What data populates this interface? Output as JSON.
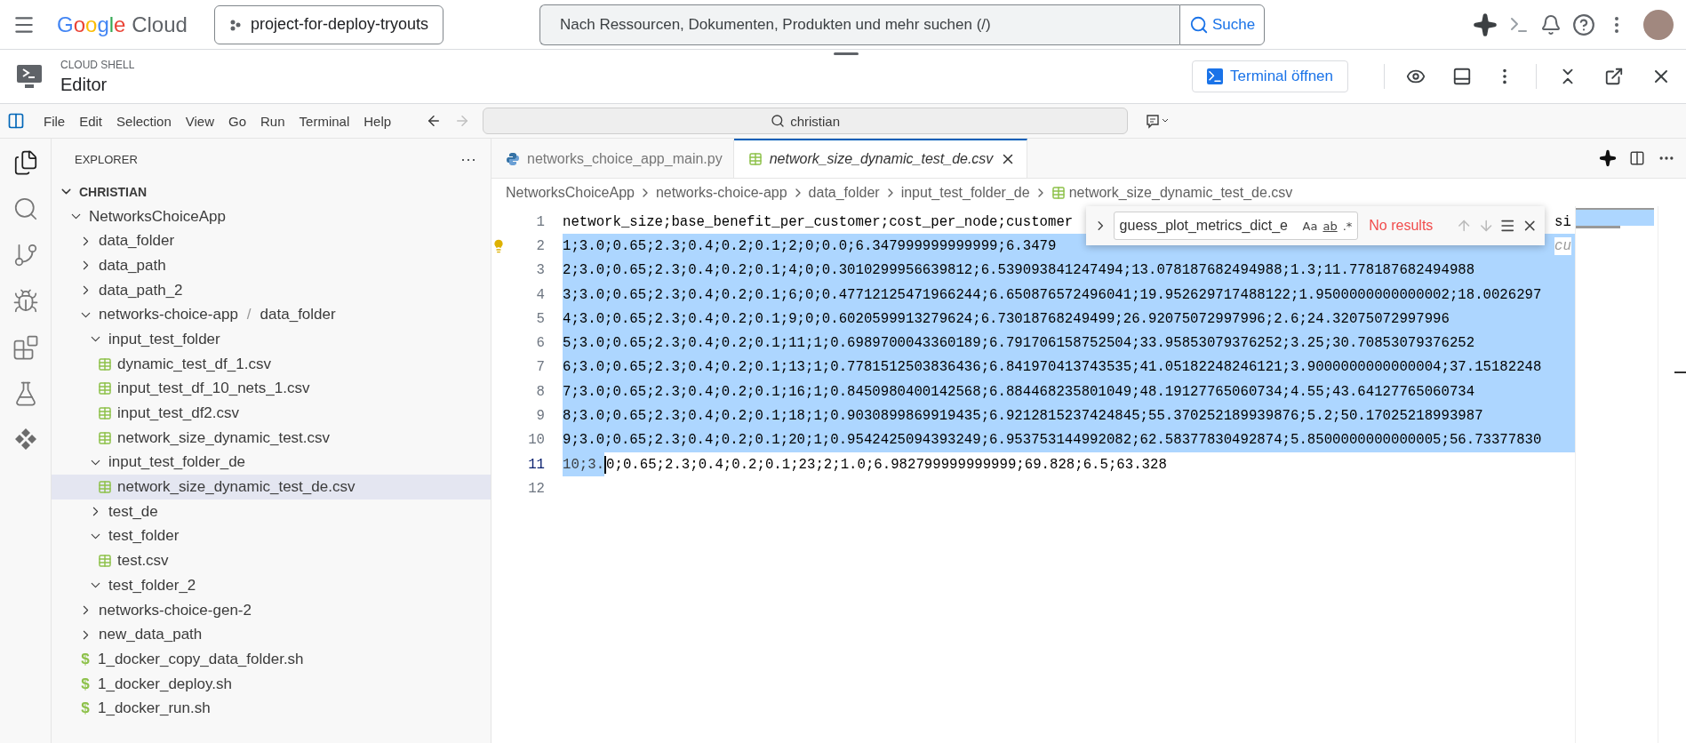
{
  "top_bar": {
    "logo": "Google Cloud",
    "project": "project-for-deploy-tryouts",
    "search": {
      "placeholder": "Nach Ressourcen, Dokumenten, Produkten und mehr suchen (/)"
    },
    "search_button": "Suche"
  },
  "shell_header": {
    "overline": "CLOUD SHELL",
    "title": "Editor",
    "terminal_button": "Terminal öffnen"
  },
  "menu_bar": {
    "items": [
      "File",
      "Edit",
      "Selection",
      "View",
      "Go",
      "Run",
      "Terminal",
      "Help"
    ],
    "command_center": "christian",
    "forward_disabled": true
  },
  "activity_bar": {
    "items": [
      {
        "kind": "files",
        "selected": true
      },
      {
        "kind": "search",
        "selected": false
      },
      {
        "kind": "git",
        "selected": false
      },
      {
        "kind": "debug",
        "selected": false
      },
      {
        "kind": "extensions",
        "selected": false
      },
      {
        "kind": "flask",
        "selected": false
      },
      {
        "kind": "gemini",
        "selected": false
      }
    ]
  },
  "explorer": {
    "title": "EXPLORER",
    "more": "···",
    "root": {
      "name": "CHRISTIAN",
      "expanded": true
    },
    "tree": [
      {
        "kind": "folder",
        "name": "NetworksChoiceApp",
        "expanded": true,
        "selected": false,
        "children": [
          {
            "kind": "folder",
            "name": "data_folder",
            "expanded": false,
            "selected": false
          },
          {
            "kind": "folder",
            "name": "data_path",
            "expanded": false,
            "selected": false
          },
          {
            "kind": "folder",
            "name": "data_path_2",
            "expanded": false,
            "selected": false
          },
          {
            "kind": "folder",
            "name": "networks-choice-app",
            "separator": "/",
            "compact": "data_folder",
            "expanded": true,
            "selected": false,
            "children": [
              {
                "kind": "folder",
                "name": "input_test_folder",
                "expanded": true,
                "selected": false,
                "children": [
                  {
                    "kind": "csv",
                    "name": "dynamic_test_df_1.csv",
                    "selected": false
                  },
                  {
                    "kind": "csv",
                    "name": "input_test_df_10_nets_1.csv",
                    "selected": false
                  },
                  {
                    "kind": "csv",
                    "name": "input_test_df2.csv",
                    "selected": false
                  },
                  {
                    "kind": "csv",
                    "name": "network_size_dynamic_test.csv",
                    "selected": false
                  }
                ]
              },
              {
                "kind": "folder",
                "name": "input_test_folder_de",
                "expanded": true,
                "selected": false,
                "children": [
                  {
                    "kind": "csv",
                    "name": "network_size_dynamic_test_de.csv",
                    "selected": true
                  }
                ]
              },
              {
                "kind": "folder",
                "name": "test_de",
                "expanded": false,
                "selected": false
              },
              {
                "kind": "folder",
                "name": "test_folder",
                "expanded": true,
                "selected": false,
                "children": [
                  {
                    "kind": "csv",
                    "name": "test.csv",
                    "selected": false
                  }
                ]
              },
              {
                "kind": "folder",
                "name": "test_folder_2",
                "expanded": true,
                "selected": false
              }
            ]
          },
          {
            "kind": "folder",
            "name": "networks-choice-gen-2",
            "expanded": false,
            "selected": false
          },
          {
            "kind": "folder",
            "name": "new_data_path",
            "expanded": false,
            "selected": false
          },
          {
            "kind": "shell",
            "icon": "$",
            "name": "1_docker_copy_data_folder.sh",
            "selected": false
          },
          {
            "kind": "shell",
            "icon": "$",
            "name": "1_docker_deploy.sh",
            "selected": false
          },
          {
            "kind": "shell",
            "icon": "$",
            "name": "1_docker_run.sh",
            "selected": false
          }
        ]
      }
    ]
  },
  "tabs": [
    {
      "kind": "python",
      "label": "networks_choice_app_main.py",
      "selected": false
    },
    {
      "kind": "csv",
      "label": "network_size_dynamic_test_de.csv",
      "selected": true
    }
  ],
  "breadcrumb": [
    "NetworksChoiceApp",
    "networks-choice-app",
    "data_folder",
    "input_test_folder_de",
    "network_size_dynamic_test_de.csv"
  ],
  "find_widget": {
    "value": "guess_plot_metrics_dict_e",
    "toggles": [
      "Aa",
      "ab",
      ".*"
    ],
    "status": "No results"
  },
  "lines": [
    {
      "number": "1",
      "text": "network_size;base_benefit_per_customer;cost_per_node;customer",
      "tail": "si",
      "selected": false,
      "current": false
    },
    {
      "number": "2",
      "text": "1;3.0;0.65;2.3;0.4;0.2;0.1;2;0;0.0;6.347999999999999;6.3479",
      "tail": "cu",
      "selected": true,
      "current": false,
      "lightbulb": true
    },
    {
      "number": "3",
      "text": "2;3.0;0.65;2.3;0.4;0.2;0.1;4;0;0.3010299956639812;6.539093841247494;13.078187682494988;1.3;11.778187682494988",
      "selected": true,
      "current": false
    },
    {
      "number": "4",
      "text": "3;3.0;0.65;2.3;0.4;0.2;0.1;6;0;0.47712125471966244;6.650876572496041;19.952629717488122;1.9500000000000002;18.0026297",
      "selected": true,
      "current": false
    },
    {
      "number": "5",
      "text": "4;3.0;0.65;2.3;0.4;0.2;0.1;9;0;0.6020599913279624;6.73018768249499;26.92075072997996;2.6;24.32075072997996",
      "selected": true,
      "current": false
    },
    {
      "number": "6",
      "text": "5;3.0;0.65;2.3;0.4;0.2;0.1;11;1;0.6989700043360189;6.791706158752504;33.95853079376252;3.25;30.70853079376252",
      "selected": true,
      "current": false
    },
    {
      "number": "7",
      "text": "6;3.0;0.65;2.3;0.4;0.2;0.1;13;1;0.7781512503836436;6.841970413743535;41.05182248246121;3.9000000000000004;37.15182248",
      "selected": true,
      "current": false
    },
    {
      "number": "8",
      "text": "7;3.0;0.65;2.3;0.4;0.2;0.1;16;1;0.8450980400142568;6.884468235801049;48.19127765060734;4.55;43.64127765060734",
      "selected": true,
      "current": false
    },
    {
      "number": "9",
      "text": "8;3.0;0.65;2.3;0.4;0.2;0.1;18;1;0.9030899869919435;6.9212815237424845;55.370252189939876;5.2;50.17025218993987",
      "selected": true,
      "current": false
    },
    {
      "number": "10",
      "text": "9;3.0;0.65;2.3;0.4;0.2;0.1;20;1;0.9542425094393249;6.953753144992082;62.58377830492874;5.8500000000000005;56.73377830",
      "selected": true,
      "current": false
    },
    {
      "number": "11",
      "selected_text": "10;3.",
      "text": "0;0.65;2.3;0.4;0.2;0.1;23;2;1.0;6.982799999999999;69.828;6.5;63.328",
      "selected": false,
      "current": true
    },
    {
      "number": "12",
      "selected": false,
      "current": false
    }
  ]
}
